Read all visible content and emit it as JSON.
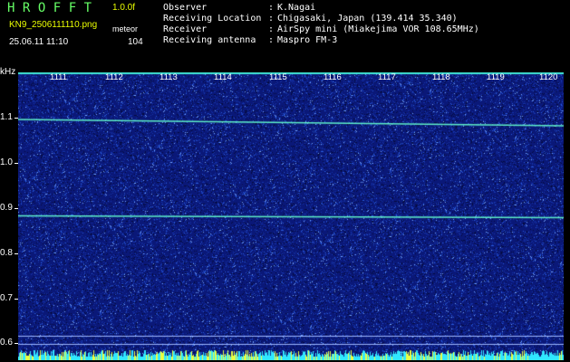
{
  "header": {
    "app_title": "HROFFT",
    "version": "1.0.0f",
    "filename": "KN9_2506111110.png",
    "meteor_label": "meteor",
    "datetime": "25.06.11 11:10",
    "meteor_count": "104"
  },
  "info": [
    {
      "label": "Observer",
      "sep": ":",
      "value": "K.Nagai"
    },
    {
      "label": "Receiving Location",
      "sep": ":",
      "value": "Chigasaki, Japan (139.414 35.340)"
    },
    {
      "label": "Receiver",
      "sep": ":",
      "value": "AirSpy mini (Miakejima VOR 108.65MHz)"
    },
    {
      "label": "Receiving antenna",
      "sep": ":",
      "value": "Maspro FM-3"
    }
  ],
  "y_axis": {
    "unit": "kHz",
    "ticks": [
      "1.1",
      "1.0",
      "0.9",
      "0.8",
      "0.7",
      "0.6"
    ]
  },
  "time_axis": {
    "labels": [
      "1111",
      "1112",
      "1113",
      "1114",
      "1115",
      "1116",
      "1117",
      "1118",
      "1119",
      "1120"
    ]
  },
  "colors": {
    "background": "#000000",
    "spectrogram_base": "#0b1a80",
    "signal_line": "#5ef0c8",
    "title": "#66ff66",
    "accent_yellow": "#eaff00"
  }
}
